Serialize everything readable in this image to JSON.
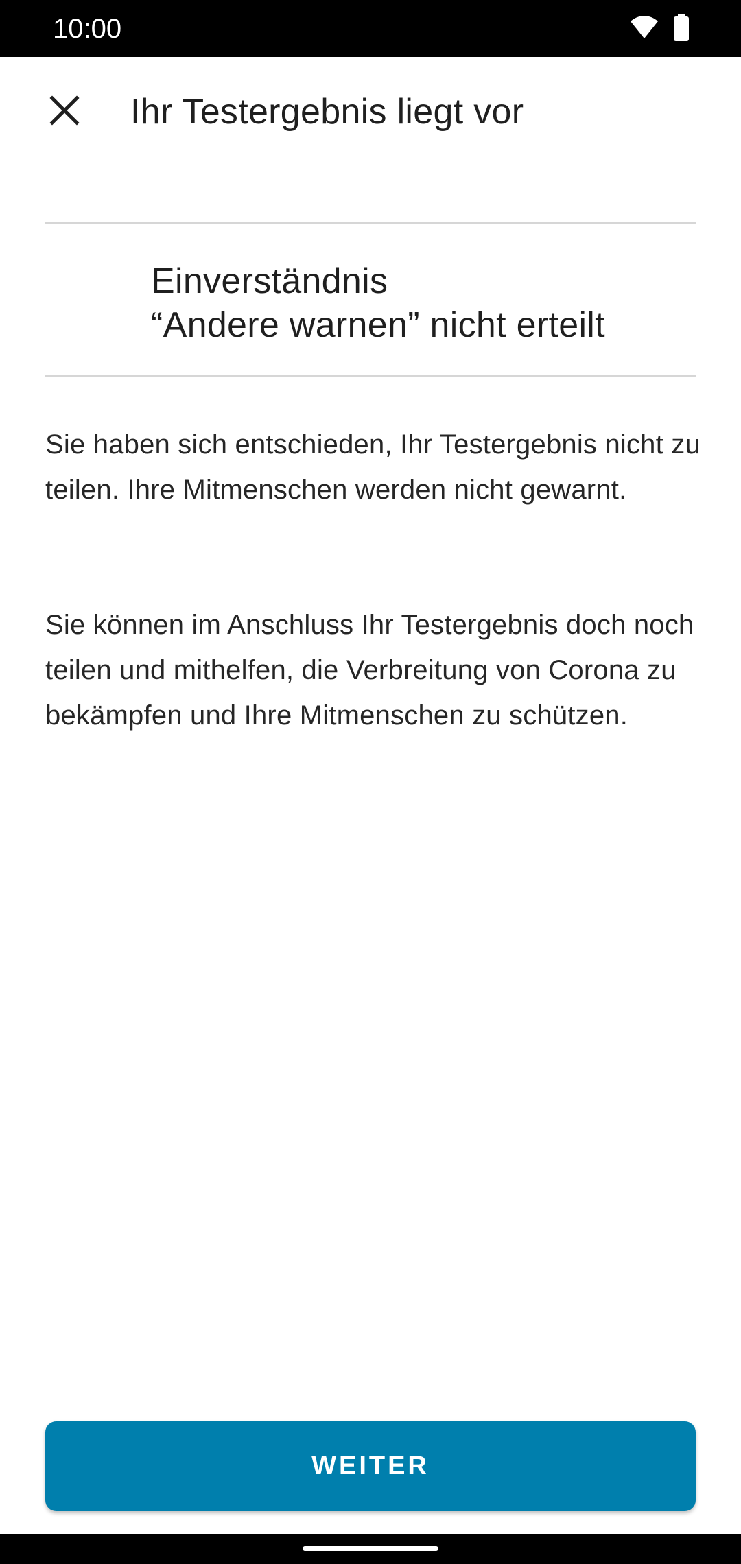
{
  "status_bar": {
    "time": "10:00",
    "icons": [
      "wifi-icon",
      "battery-icon"
    ]
  },
  "toolbar": {
    "close_icon": "close-icon",
    "title": "Ihr Testergebnis liegt vor"
  },
  "heading": {
    "line1": "Einverständnis",
    "line2": "“Andere warnen” nicht erteilt"
  },
  "body": {
    "paragraph1": "Sie haben sich entschieden, Ihr Testergebnis nicht zu teilen. Ihre Mitmenschen werden nicht gewarnt.",
    "paragraph2": "Sie können im Anschluss Ihr Testergebnis doch noch teilen und mithelfen, die Verbreitung von Corona zu bekämpfen und Ihre Mitmenschen zu schützen."
  },
  "actions": {
    "weiter_label": "WEITER"
  },
  "colors": {
    "primary_button": "#007fad",
    "text": "#1f1f1f",
    "divider": "#d6d6d6"
  }
}
